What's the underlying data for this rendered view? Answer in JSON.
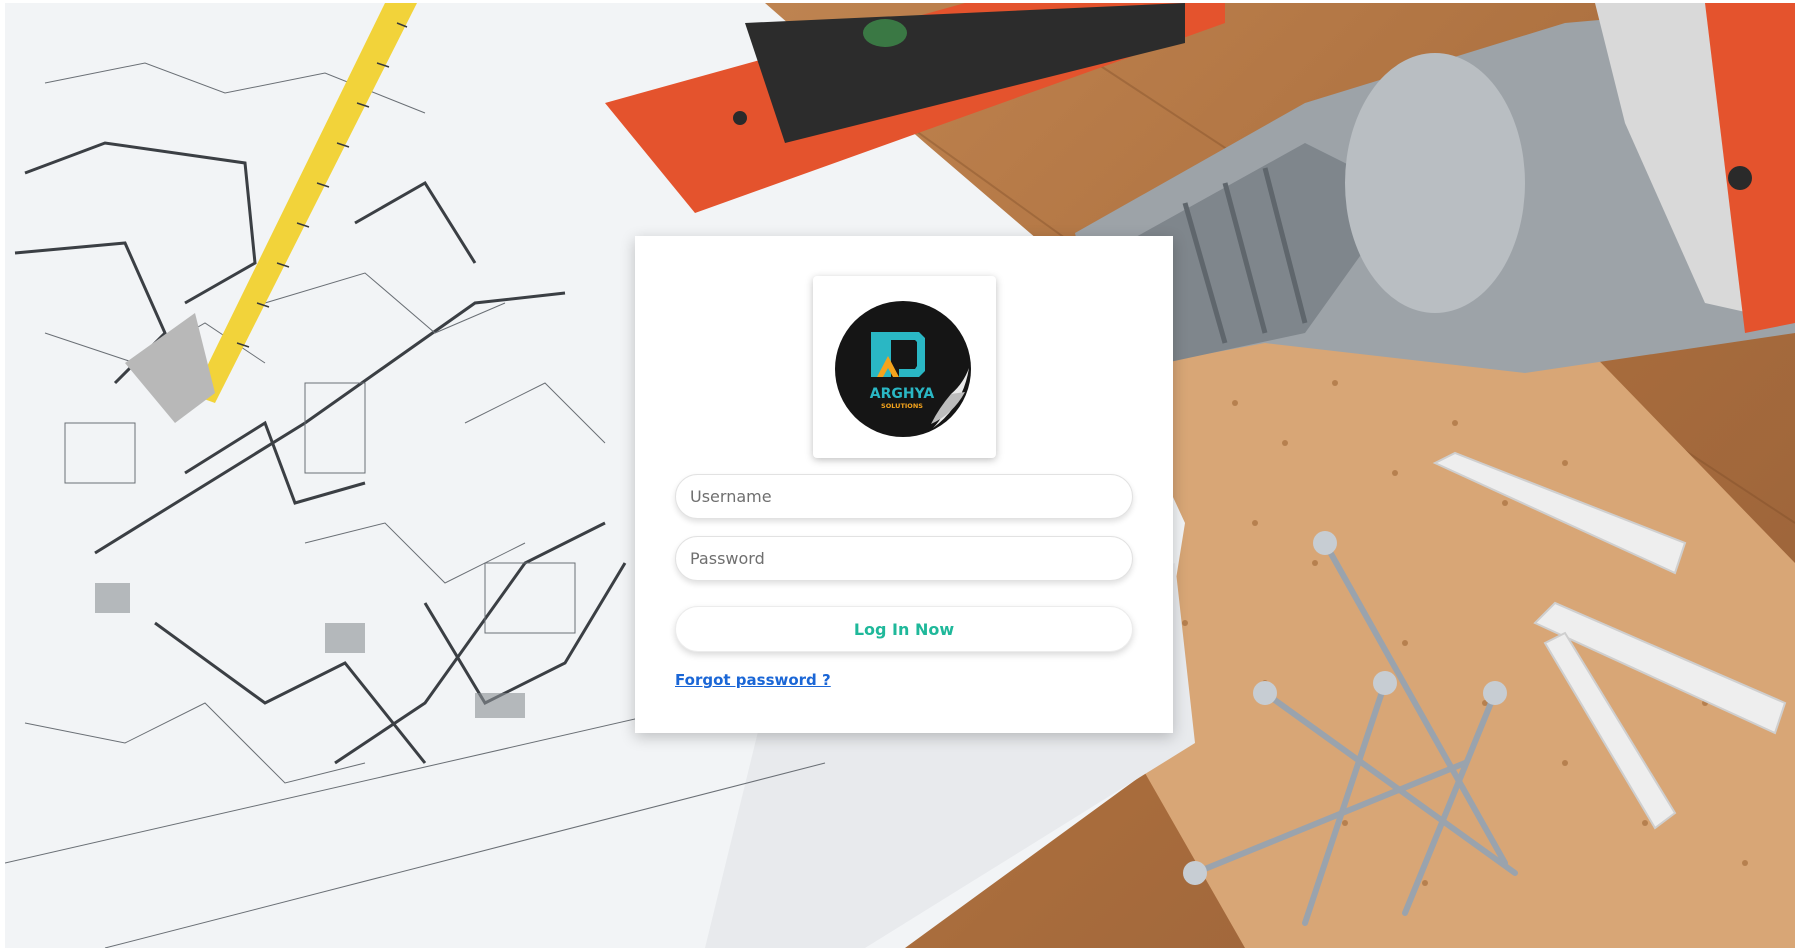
{
  "login": {
    "username_placeholder": "Username",
    "password_placeholder": "Password",
    "submit_label": "Log In Now",
    "forgot_label": "Forgot password ?"
  },
  "logo": {
    "brand_name": "ARGHYA",
    "brand_tagline": "SOLUTIONS"
  },
  "colors": {
    "accent": "#1fb89a",
    "link": "#1a66d6",
    "logo_teal": "#2ab7c4",
    "logo_orange": "#f4a31c"
  },
  "icons": {
    "background": "construction-blueprint-tools-photo",
    "logo": "arghya-solutions-sticker-logo"
  }
}
